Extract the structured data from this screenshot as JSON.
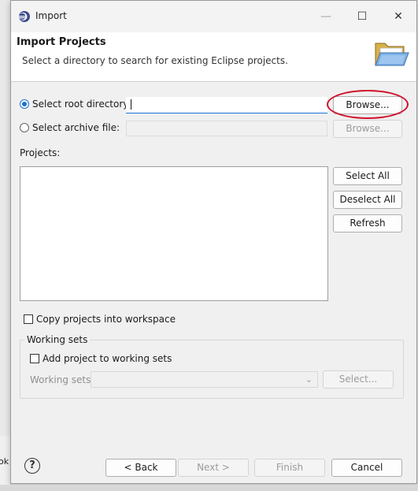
{
  "window": {
    "title": "Import",
    "controls": {
      "minimize": "—",
      "maximize": "☐",
      "close": "✕"
    }
  },
  "header": {
    "title": "Import Projects",
    "description": "Select a directory to search for existing Eclipse projects."
  },
  "source": {
    "root_option_label": "Select root directory:",
    "root_option_selected": true,
    "root_path_value": "",
    "root_browse_label": "Browse...",
    "archive_option_label": "Select archive file:",
    "archive_option_selected": false,
    "archive_path_value": "",
    "archive_browse_label": "Browse..."
  },
  "projects": {
    "label": "Projects:",
    "items": [],
    "select_all_label": "Select All",
    "deselect_all_label": "Deselect All",
    "refresh_label": "Refresh"
  },
  "options": {
    "copy_into_workspace_label": "Copy projects into workspace",
    "copy_into_workspace_checked": false
  },
  "working_sets": {
    "group_title": "Working sets",
    "add_label": "Add project to working sets",
    "add_checked": false,
    "sets_label": "Working sets:",
    "sets_value": "",
    "select_label": "Select..."
  },
  "footer": {
    "back_label": "< Back",
    "next_label": "Next >",
    "finish_label": "Finish",
    "cancel_label": "Cancel"
  },
  "background": {
    "partial_text": "ok"
  },
  "colors": {
    "accent": "#1a6fd1",
    "annotation": "#d0102a"
  }
}
